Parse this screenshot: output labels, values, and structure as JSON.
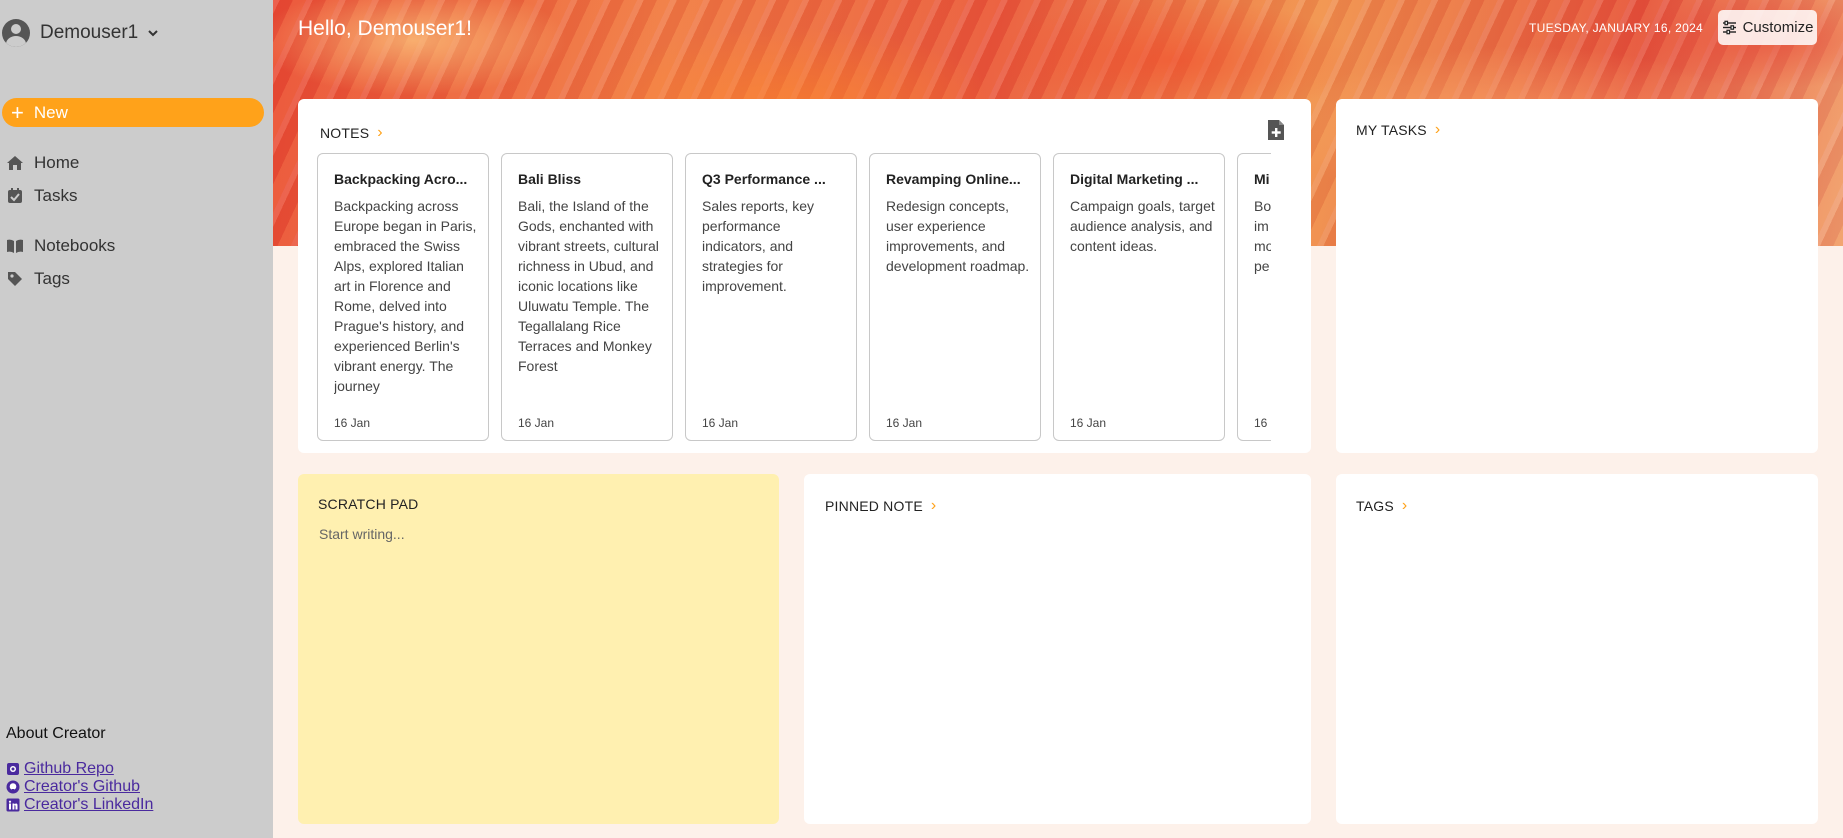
{
  "user": {
    "name": "Demouser1"
  },
  "sidebar": {
    "new_label": "New",
    "nav": [
      {
        "label": "Home",
        "icon": "home-icon"
      },
      {
        "label": "Tasks",
        "icon": "task-check-icon"
      },
      {
        "label": "Notebooks",
        "icon": "book-icon"
      },
      {
        "label": "Tags",
        "icon": "tag-icon"
      }
    ],
    "about_title": "About Creator",
    "links": [
      {
        "label": "Github Repo",
        "icon": "repo-icon"
      },
      {
        "label": "Creator's Github",
        "icon": "github-icon"
      },
      {
        "label": "Creator's LinkedIn",
        "icon": "linkedin-icon"
      }
    ]
  },
  "header": {
    "greeting": "Hello, Demouser1!",
    "date": "TUESDAY, JANUARY 16, 2024",
    "customize_label": "Customize"
  },
  "notes": {
    "title": "NOTES",
    "items": [
      {
        "title": "Backpacking Acro...",
        "body": "Backpacking across Europe began in Paris, embraced the Swiss Alps, explored Italian art in Florence and Rome, delved into Prague's history, and experienced Berlin's vibrant energy. The journey",
        "date": "16 Jan"
      },
      {
        "title": "Bali Bliss",
        "body": "Bali, the Island of the Gods, enchanted with vibrant streets, cultural richness in Ubud, and iconic locations like Uluwatu Temple. The Tegallalang Rice Terraces and Monkey Forest",
        "date": "16 Jan"
      },
      {
        "title": "Q3 Performance ...",
        "body": "Sales reports, key performance indicators, and strategies for improvement.",
        "date": "16 Jan"
      },
      {
        "title": "Revamping Online...",
        "body": "Redesign concepts, user experience improvements, and development roadmap.",
        "date": "16 Jan"
      },
      {
        "title": "Digital Marketing ...",
        "body": "Campaign goals, target audience analysis, and content ideas.",
        "date": "16 Jan"
      },
      {
        "title": "Mi",
        "body": "Bo im mo pe",
        "date": "16"
      }
    ]
  },
  "tasks": {
    "title": "MY TASKS"
  },
  "scratch": {
    "title": "SCRATCH PAD",
    "placeholder": "Start writing..."
  },
  "pinned": {
    "title": "PINNED NOTE"
  },
  "tags": {
    "title": "TAGS"
  },
  "colors": {
    "accent": "#ffa21a",
    "sidebar": "#cccccc",
    "scratch_bg": "#fff0b0",
    "page_bg": "#fdf1ea"
  }
}
